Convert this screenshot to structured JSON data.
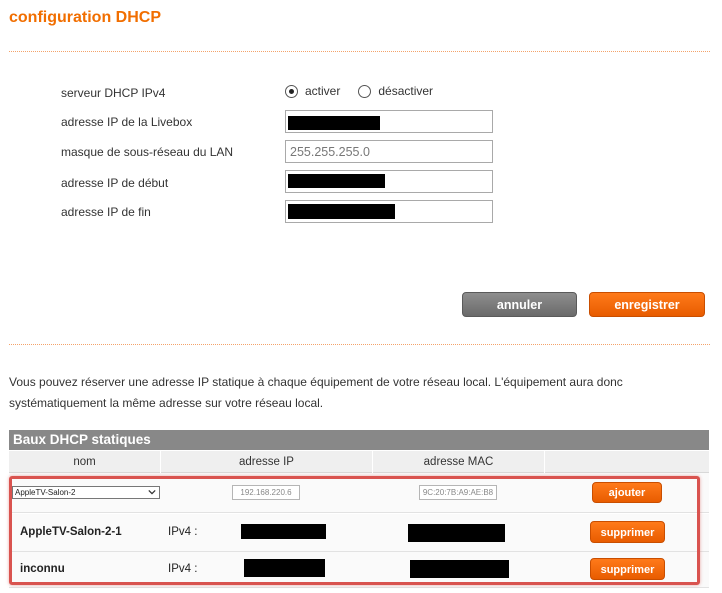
{
  "page": {
    "title": "configuration DHCP"
  },
  "dhcp_form": {
    "server_label": "serveur DHCP IPv4",
    "radio_enable": "activer",
    "radio_disable": "désactiver",
    "enabled": true,
    "livebox_ip_label": "adresse IP de la Livebox",
    "livebox_ip_value": "",
    "subnet_label": "masque de sous-réseau du LAN",
    "subnet_value": "255.255.255.0",
    "start_ip_label": "adresse IP de début",
    "start_ip_value": "",
    "end_ip_label": "adresse IP de fin",
    "end_ip_value": ""
  },
  "actions": {
    "cancel": "annuler",
    "save": "enregistrer"
  },
  "info": {
    "text": "Vous pouvez réserver une adresse IP statique à chaque équipement de votre réseau local. L'équipement aura donc systématiquement la même adresse sur votre réseau local."
  },
  "static_leases": {
    "title": "Baux DHCP statiques",
    "columns": [
      "nom",
      "adresse IP",
      "adresse MAC",
      ""
    ],
    "new_entry": {
      "device_selected": "AppleTV-Salon-2",
      "ip_placeholder": "192.168.220.6",
      "mac_placeholder": "9C:20:7B:A9:AE:B8",
      "add_label": "ajouter"
    },
    "rows": [
      {
        "name": "AppleTV-Salon-2-1",
        "ip_prefix": "IPv4 :",
        "delete_label": "supprimer"
      },
      {
        "name": "inconnu",
        "ip_prefix": "IPv4 :",
        "delete_label": "supprimer"
      }
    ]
  },
  "colors": {
    "accent": "#f16e00",
    "highlight_frame": "#d9534f",
    "table_header": "#888888"
  }
}
